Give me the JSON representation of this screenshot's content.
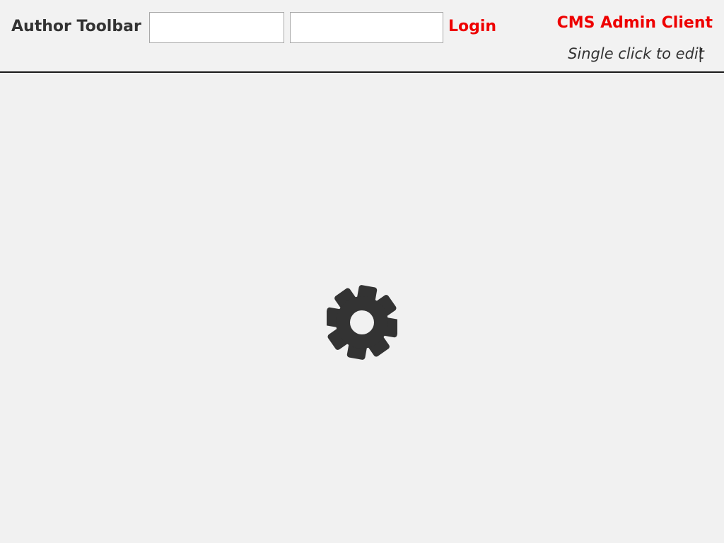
{
  "toolbar": {
    "title": "Author Toolbar",
    "username": {
      "value": "",
      "placeholder": ""
    },
    "password": {
      "value": "",
      "placeholder": ""
    },
    "login_label": "Login",
    "cms_title": "CMS Admin Client",
    "edit_hint": "Single click to edit",
    "edit_hint_separator": "|"
  },
  "main": {
    "loading_icon": "gear-icon"
  },
  "colors": {
    "accent": "#ee0000",
    "text": "#333333",
    "background": "#f1f1f1",
    "divider": "#1a1a1a"
  }
}
